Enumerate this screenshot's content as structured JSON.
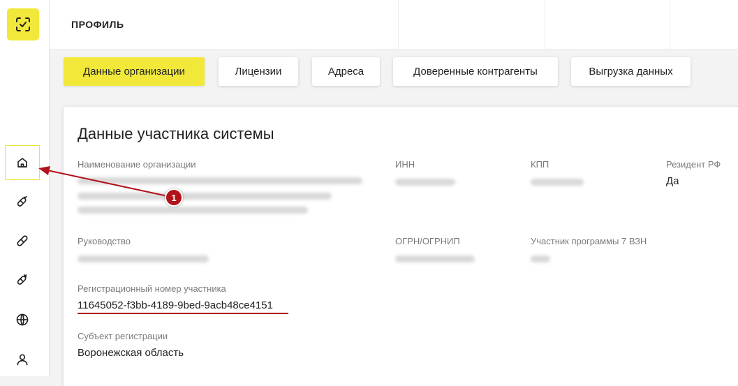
{
  "header": {
    "title": "ПРОФИЛЬ"
  },
  "sidebar": {
    "logo_icon": "scan-check-icon",
    "items": [
      {
        "icon": "home-icon",
        "active": true
      },
      {
        "icon": "pill-check-icon"
      },
      {
        "icon": "pill-icon"
      },
      {
        "icon": "pill-x-icon"
      },
      {
        "icon": "globe-icon"
      },
      {
        "icon": "user-icon"
      }
    ]
  },
  "tabs": [
    {
      "label": "Данные организации",
      "active": true
    },
    {
      "label": "Лицензии"
    },
    {
      "label": "Адреса"
    },
    {
      "label": "Доверенные контрагенты"
    },
    {
      "label": "Выгрузка данных"
    }
  ],
  "card": {
    "title": "Данные участника системы",
    "fields": {
      "org_name_label": "Наименование организации",
      "inn_label": "ИНН",
      "kpp_label": "КПП",
      "resident_label": "Резидент РФ",
      "resident_value": "Да",
      "management_label": "Руководство",
      "ogrn_label": "ОГРН/ОГРНИП",
      "program_label": "Участник программы 7 ВЗН",
      "reg_number_label": "Регистрационный номер участника",
      "reg_number_value": "11645052-f3bb-4189-9bed-9acb48ce4151",
      "subject_label": "Субъект регистрации",
      "subject_value": "Воронежская область"
    }
  },
  "annotation": {
    "badge": "1"
  },
  "colors": {
    "accent": "#f1e83a",
    "annotation": "#b2121a"
  }
}
